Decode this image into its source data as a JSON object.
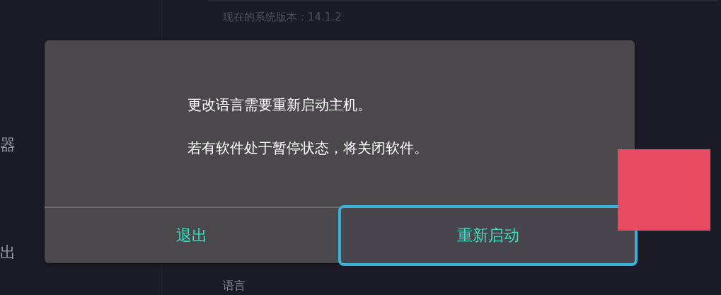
{
  "background": {
    "sidebar": {
      "items": [
        "器",
        "出"
      ]
    },
    "version_text": "现在的系统版本：14.1.2",
    "section_label": "语言"
  },
  "dialog": {
    "messages": [
      "更改语言需要重新启动主机。",
      "若有软件处于暂停状态，将关闭软件。"
    ],
    "buttons": [
      {
        "label": "退出",
        "selected": false
      },
      {
        "label": "重新启动",
        "selected": true
      }
    ]
  }
}
